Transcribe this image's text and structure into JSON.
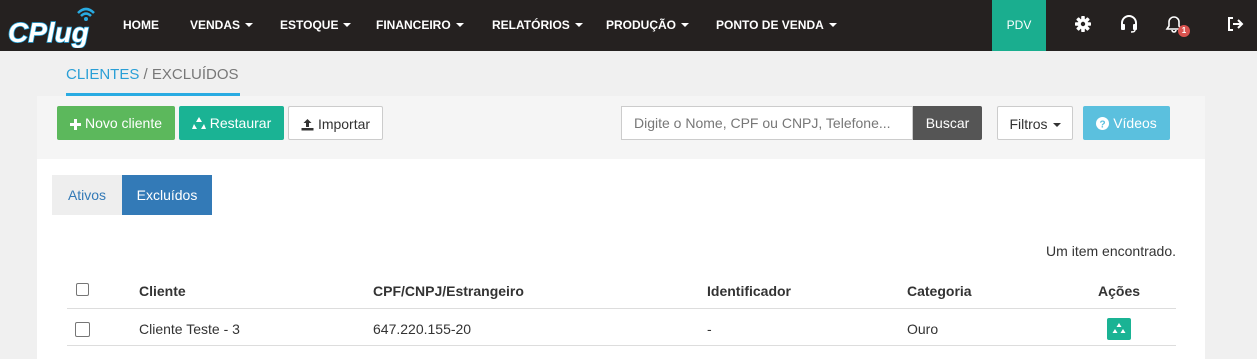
{
  "brand": {
    "logo_text": "CPlug"
  },
  "nav": {
    "items": [
      {
        "label": "HOME",
        "has_caret": false
      },
      {
        "label": "VENDAS",
        "has_caret": true
      },
      {
        "label": "ESTOQUE",
        "has_caret": true
      },
      {
        "label": "FINANCEIRO",
        "has_caret": true
      },
      {
        "label": "RELATÓRIOS",
        "has_caret": true
      },
      {
        "label": "PRODUÇÃO",
        "has_caret": true
      },
      {
        "label": "PONTO DE VENDA",
        "has_caret": true
      }
    ],
    "pdv_label": "PDV",
    "notification_count": "1",
    "icons": [
      "gear-icon",
      "headset-icon",
      "bell-icon",
      "logout-icon"
    ]
  },
  "breadcrumb": {
    "link": "CLIENTES",
    "separator": "/",
    "current": "EXCLUÍDOS"
  },
  "toolbar": {
    "new_client_label": "Novo cliente",
    "restore_label": "Restaurar",
    "import_label": "Importar",
    "search_placeholder": "Digite o Nome, CPF ou CNPJ, Telefone...",
    "search_value": "",
    "search_button_label": "Buscar",
    "filters_label": "Filtros",
    "videos_label": "Vídeos"
  },
  "tabs": [
    {
      "label": "Ativos",
      "active": false
    },
    {
      "label": "Excluídos",
      "active": true
    }
  ],
  "results": {
    "count_text": "Um item encontrado."
  },
  "table": {
    "headers": {
      "cliente": "Cliente",
      "documento": "CPF/CNPJ/Estrangeiro",
      "identificador": "Identificador",
      "categoria": "Categoria",
      "acoes": "Ações"
    },
    "rows": [
      {
        "cliente": "Cliente Teste - 3",
        "documento": "647.220.155-20",
        "identificador": "-",
        "categoria": "Ouro",
        "action_icon": "recycle-icon"
      }
    ]
  },
  "colors": {
    "topbar": "#252120",
    "accent_teal": "#1ab394",
    "pdv": "#1aae8f",
    "green": "#5cb85c",
    "primary_blue": "#337ab7",
    "info": "#5bc0de",
    "link_blue": "#2a9fd6",
    "badge_red": "#d9534f"
  }
}
